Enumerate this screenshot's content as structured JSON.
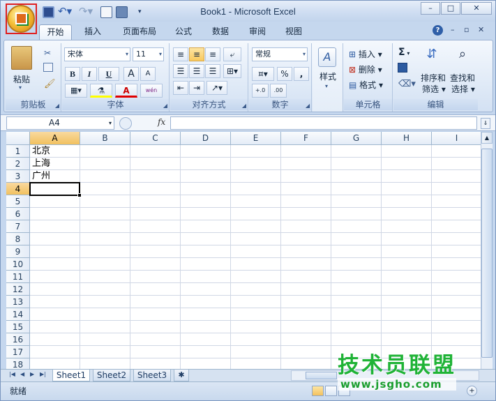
{
  "window": {
    "title": "Book1 - Microsoft Excel",
    "min": "–",
    "max": "□",
    "close": "✕"
  },
  "tabs": [
    "开始",
    "插入",
    "页面布局",
    "公式",
    "数据",
    "审阅",
    "视图"
  ],
  "ribbon": {
    "clipboard": {
      "paste": "粘贴",
      "label": "剪贴板"
    },
    "font": {
      "name": "宋体",
      "size": "11",
      "bold": "B",
      "italic": "I",
      "underline": "U",
      "grow": "A",
      "shrink": "A",
      "color_letter": "A",
      "phonetic": "wén",
      "label": "字体"
    },
    "alignment": {
      "label": "对齐方式"
    },
    "number": {
      "format": "常规",
      "percent": "%",
      "comma": ",",
      "inc_decimal": "+.0",
      "dec_decimal": ".00",
      "label": "数字"
    },
    "styles": {
      "label": "样式"
    },
    "cells": {
      "insert": "插入",
      "delete": "删除",
      "format": "格式",
      "label": "单元格"
    },
    "editing": {
      "sigma": "Σ",
      "sort": "排序和",
      "filter": "筛选",
      "find": "查找和",
      "select": "选择",
      "label": "编辑"
    }
  },
  "formula_bar": {
    "name_box": "A4",
    "fx": "fx",
    "value": ""
  },
  "columns": [
    "A",
    "B",
    "C",
    "D",
    "E",
    "F",
    "G",
    "H",
    "I"
  ],
  "rows": [
    "1",
    "2",
    "3",
    "4",
    "5",
    "6",
    "7",
    "8",
    "9",
    "10",
    "11",
    "12",
    "13",
    "14",
    "15",
    "16",
    "17",
    "18"
  ],
  "cells": {
    "A1": "北京",
    "A2": "上海",
    "A3": "广州"
  },
  "active_cell": "A4",
  "sheets": [
    "Sheet1",
    "Sheet2",
    "Sheet3"
  ],
  "status": "就绪",
  "watermark": {
    "main": "技术员联盟",
    "url": "www.jsgho.com"
  }
}
